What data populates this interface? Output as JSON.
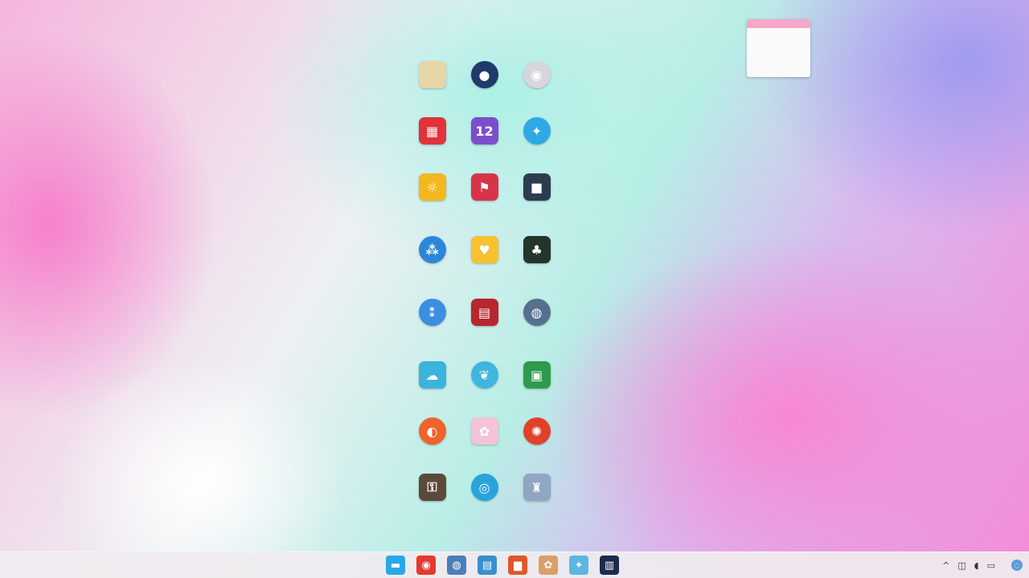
{
  "desktop_icons": [
    {
      "name": "folder-icon",
      "glyph": "",
      "label": "",
      "bg": "#e8d5a8",
      "round": false,
      "tall": false
    },
    {
      "name": "robot-app-icon",
      "glyph": "●",
      "label": "",
      "bg": "#1f3a6b",
      "round": true,
      "tall": false
    },
    {
      "name": "disc-app-icon",
      "glyph": "◉",
      "label": "",
      "bg": "#d6d6de",
      "round": true,
      "tall": false
    },
    {
      "name": "red-app-icon",
      "glyph": "▦",
      "label": "",
      "bg": "#e0333c",
      "round": false,
      "tall": false
    },
    {
      "name": "calendar-app-icon",
      "glyph": "12",
      "label": "",
      "bg": "#7b4fc9",
      "round": false,
      "tall": false
    },
    {
      "name": "bluebird-app-icon",
      "glyph": "✦",
      "label": "",
      "bg": "#2fa8e8",
      "round": true,
      "tall": false
    },
    {
      "name": "yellow-app-icon",
      "glyph": "☼",
      "label": "",
      "bg": "#f2b81e",
      "round": false,
      "tall": false
    },
    {
      "name": "flag-app-icon",
      "glyph": "⚑",
      "label": "",
      "bg": "#d7344a",
      "round": false,
      "tall": false
    },
    {
      "name": "cat-app-icon",
      "glyph": "■",
      "label": "",
      "bg": "#2c3d4f",
      "round": false,
      "tall": true
    },
    {
      "name": "dots-app-icon",
      "glyph": "⁂",
      "label": "",
      "bg": "#2b86d9",
      "round": true,
      "tall": true
    },
    {
      "name": "heart-app-icon",
      "glyph": "♥",
      "label": "",
      "bg": "#f7c130",
      "round": false,
      "tall": false
    },
    {
      "name": "tree-app-icon",
      "glyph": "♣",
      "label": "",
      "bg": "#24362b",
      "round": false,
      "tall": false
    },
    {
      "name": "people-app-icon",
      "glyph": "⁑",
      "label": "",
      "bg": "#3b8fe0",
      "round": true,
      "tall": false
    },
    {
      "name": "grid-app-icon",
      "glyph": "▤",
      "label": "",
      "bg": "#b8272f",
      "round": false,
      "tall": false
    },
    {
      "name": "globe-app-icon",
      "glyph": "◍",
      "label": "",
      "bg": "#55708f",
      "round": true,
      "tall": true
    },
    {
      "name": "cloud-app-icon",
      "glyph": "☁",
      "label": "",
      "bg": "#3cb3dc",
      "round": false,
      "tall": false
    },
    {
      "name": "leaf-app-icon",
      "glyph": "❦",
      "label": "",
      "bg": "#3fb6df",
      "round": true,
      "tall": false
    },
    {
      "name": "map-app-icon",
      "glyph": "▣",
      "label": "",
      "bg": "#2f9a4d",
      "round": false,
      "tall": false
    },
    {
      "name": "firefox-icon",
      "glyph": "◐",
      "label": "",
      "bg": "#f0632a",
      "round": true,
      "tall": false
    },
    {
      "name": "kawaii-app-icon",
      "glyph": "✿",
      "label": "",
      "bg": "#f4c3d6",
      "round": false,
      "tall": false
    },
    {
      "name": "badge-app-icon",
      "glyph": "✺",
      "label": "",
      "bg": "#e2402a",
      "round": true,
      "tall": false
    },
    {
      "name": "archive-app-icon",
      "glyph": "⚿",
      "label": "",
      "bg": "#5b4a3a",
      "round": false,
      "tall": true
    },
    {
      "name": "eye-app-icon",
      "glyph": "◎",
      "label": "",
      "bg": "#2aa3dd",
      "round": true,
      "tall": true
    },
    {
      "name": "tower-app-icon",
      "glyph": "♜",
      "label": "",
      "bg": "#8fa6c4",
      "round": false,
      "tall": true
    }
  ],
  "calendar": {
    "cells": [
      "",
      "",
      "",
      "",
      "",
      "",
      "",
      "",
      "",
      "",
      "",
      "",
      "",
      "",
      "",
      "",
      "",
      "",
      "",
      "",
      "",
      "",
      "",
      "",
      "",
      "",
      "",
      "",
      "",
      "",
      "",
      "",
      "",
      ""
    ]
  },
  "taskbar": {
    "apps": [
      {
        "name": "start-taskbar-icon",
        "glyph": "▬",
        "bg": "#28a8e8"
      },
      {
        "name": "chrome-taskbar-icon",
        "glyph": "◉",
        "bg": "#e53a2f"
      },
      {
        "name": "globe-taskbar-icon",
        "glyph": "◍",
        "bg": "#4a7fb8"
      },
      {
        "name": "files-taskbar-icon",
        "glyph": "▤",
        "bg": "#3a8fd0"
      },
      {
        "name": "folder-taskbar-icon",
        "glyph": "▆",
        "bg": "#e0562a"
      },
      {
        "name": "paint-taskbar-icon",
        "glyph": "✿",
        "bg": "#d9a06a"
      },
      {
        "name": "app-taskbar-icon",
        "glyph": "✦",
        "bg": "#5cb8e0"
      },
      {
        "name": "dark-taskbar-icon",
        "glyph": "▥",
        "bg": "#1c2a4d"
      }
    ],
    "tray": {
      "chevron": "^",
      "time": "",
      "date": ""
    }
  }
}
